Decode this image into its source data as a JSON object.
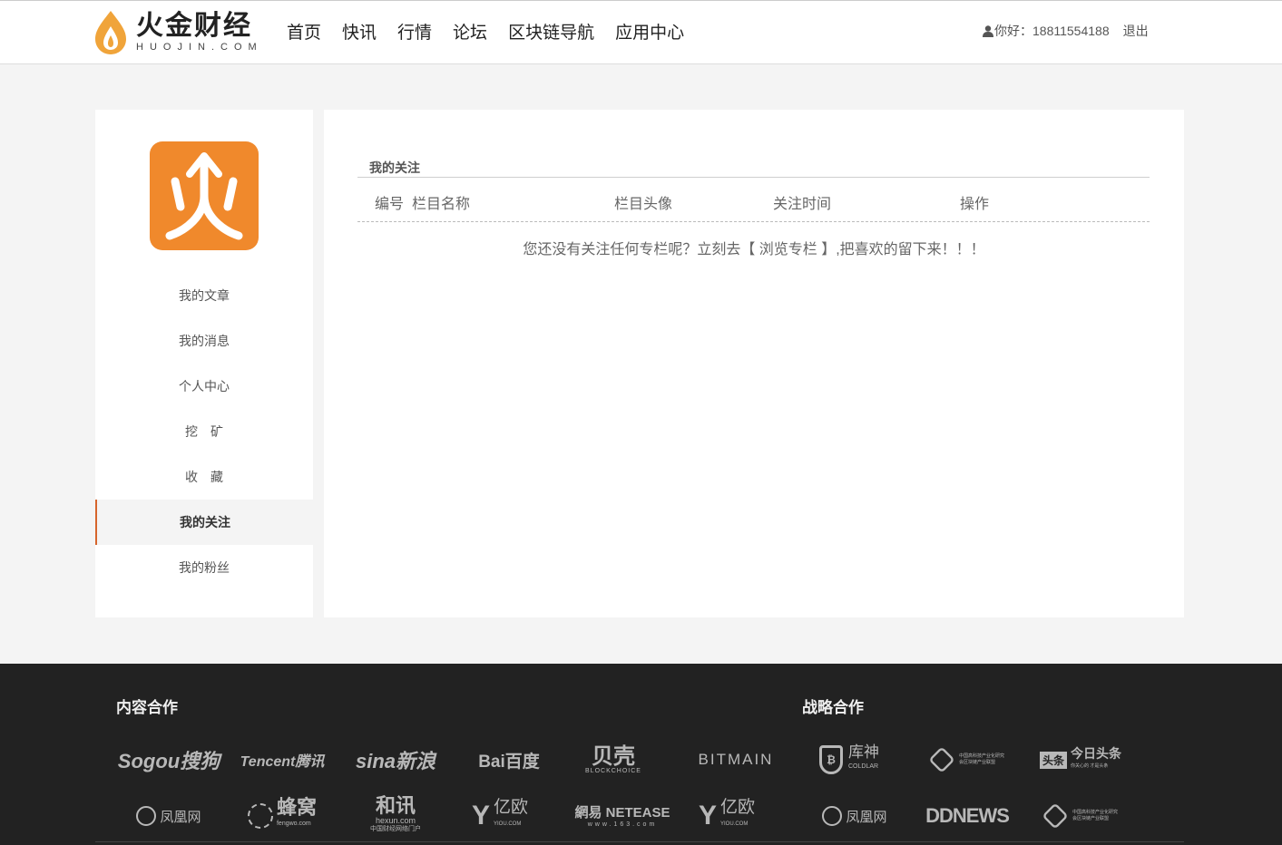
{
  "header": {
    "logo_cn": "火金财经",
    "logo_en": "HUOJIN.COM",
    "nav": [
      "首页",
      "快讯",
      "行情",
      "论坛",
      "区块链导航",
      "应用中心"
    ],
    "greeting": "你好：18811554188",
    "logout": "退出"
  },
  "sidebar": {
    "items": [
      "我的文章",
      "我的消息",
      "个人中心",
      "挖　矿",
      "收　藏",
      "我的关注",
      "我的粉丝"
    ],
    "active": "我的关注"
  },
  "main": {
    "section_title": "我的关注",
    "columns": [
      "编号",
      "栏目名称",
      "栏目头像",
      "关注时间",
      "操作"
    ],
    "empty_prefix": "您还没有关注任何专栏呢？立刻去【",
    "empty_link": " 浏览专栏 ",
    "empty_suffix": "】,把喜欢的留下来！！！"
  },
  "footer": {
    "content_title": "内容合作",
    "strategy_title": "战略合作",
    "row1": [
      "Sogou搜狗",
      "Tencent腾讯",
      "sina新浪",
      "Bai百度",
      "贝壳",
      "BITMAIN",
      "库神",
      "中国高科技产业化研究会区块链产业联盟",
      "今日头条"
    ],
    "row2": [
      "凤凰网",
      "蜂窝",
      "和讯",
      "亿欧",
      "網易 NETEASE",
      "亿欧",
      "凤凰网",
      "DDNEWS",
      "中国高科技产业化研究会区块链产业联盟"
    ],
    "sub_labels": {
      "beike": "BLOCKCHOICE",
      "kushen": "COLDLAR",
      "fengwo": "fengwo.com",
      "hexun": "hexun.com",
      "hexun_sub": "中国财经网络门户",
      "yiou": "YIOU.COM",
      "netease": "www.163.com",
      "toutiao_sub": "你关心的 才是头条"
    }
  },
  "colors": {
    "brand_orange": "#f0892c",
    "active_border": "#d6652c",
    "footer_bg": "#222222"
  }
}
